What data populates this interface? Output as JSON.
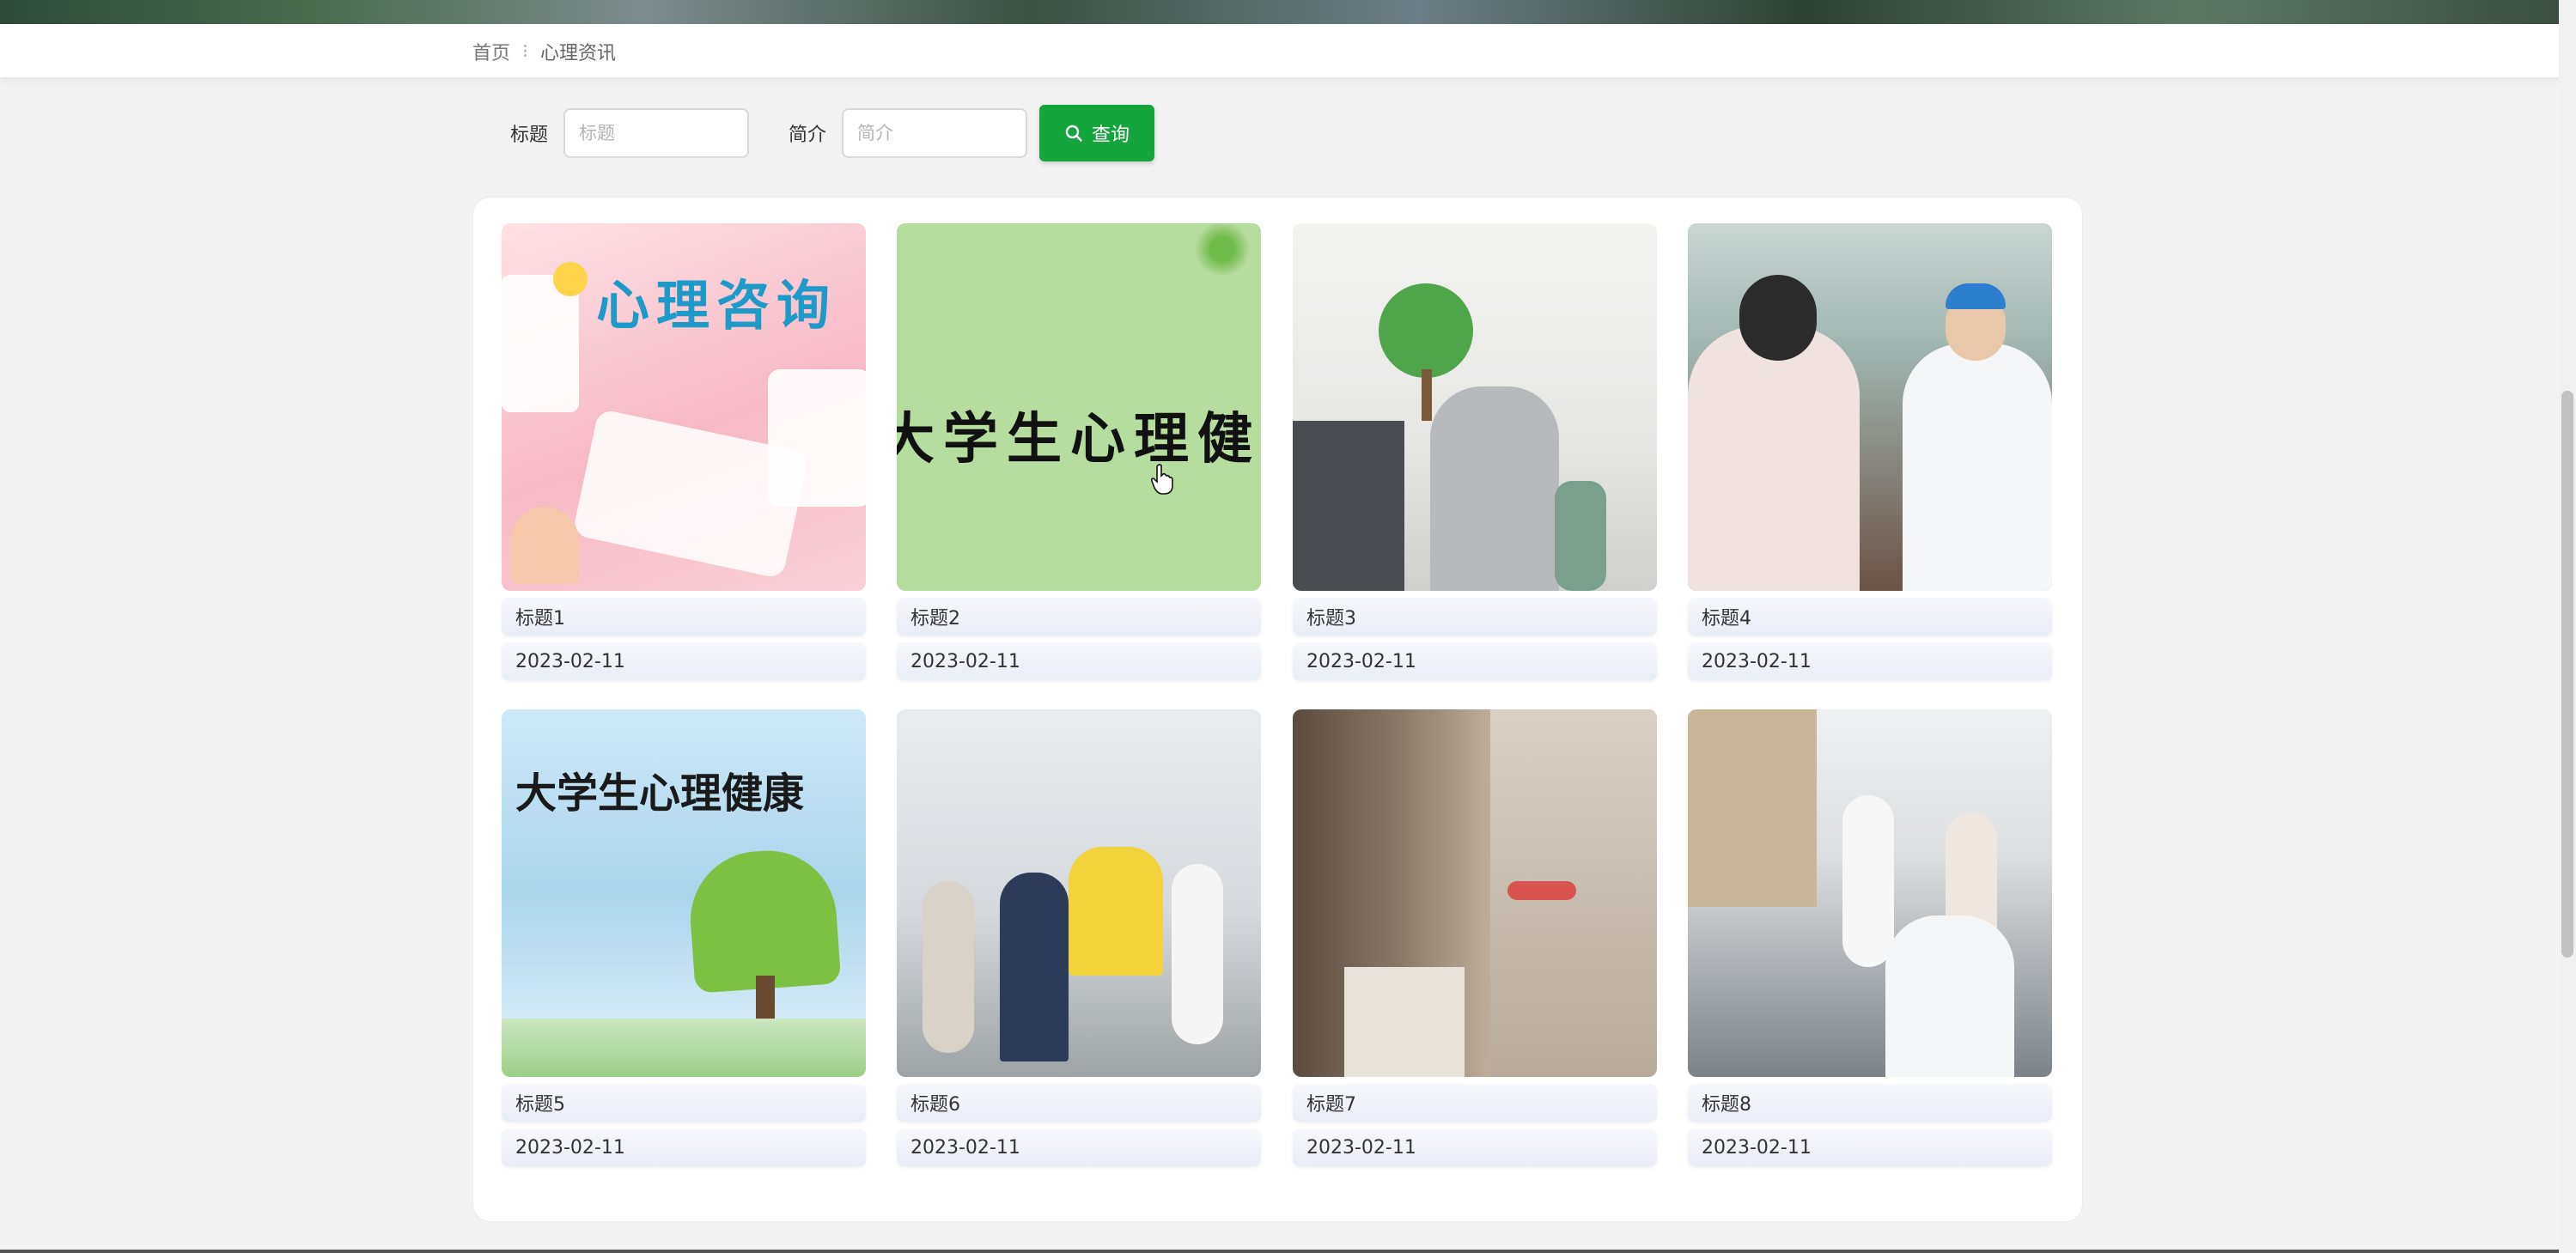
{
  "breadcrumb": {
    "home": "首页",
    "separator": "⁝",
    "current": "心理资讯"
  },
  "search": {
    "title_label": "标题",
    "title_placeholder": "标题",
    "intro_label": "简介",
    "intro_placeholder": "简介",
    "button_label": "查询",
    "button_icon": "search-icon"
  },
  "colors": {
    "accent": "#14a53c",
    "background": "#f3f3f3"
  },
  "cards": [
    {
      "title": "标题1",
      "date": "2023-02-11",
      "image_text": "心理咨询"
    },
    {
      "title": "标题2",
      "date": "2023-02-11",
      "image_text": "大学生心理健康"
    },
    {
      "title": "标题3",
      "date": "2023-02-11"
    },
    {
      "title": "标题4",
      "date": "2023-02-11"
    },
    {
      "title": "标题5",
      "date": "2023-02-11",
      "image_text": "大学生心理健康"
    },
    {
      "title": "标题6",
      "date": "2023-02-11"
    },
    {
      "title": "标题7",
      "date": "2023-02-11"
    },
    {
      "title": "标题8",
      "date": "2023-02-11"
    }
  ]
}
